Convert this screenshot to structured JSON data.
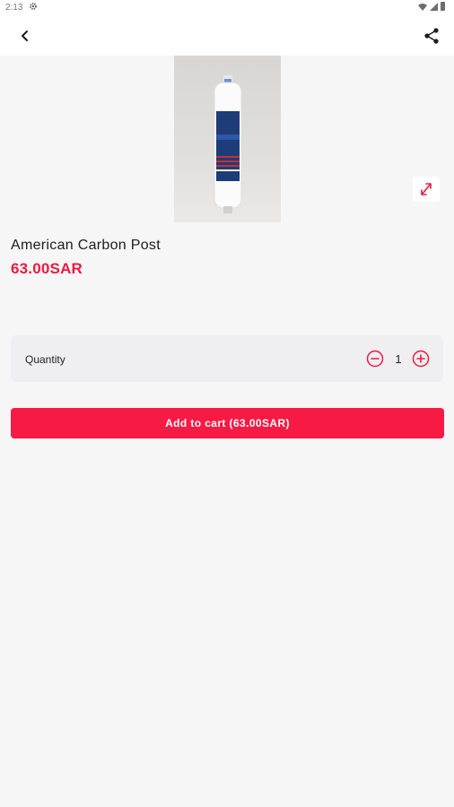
{
  "status_bar": {
    "time": "2:13",
    "icons": [
      "gear-icon",
      "wifi-icon",
      "signal-icon",
      "battery-icon"
    ]
  },
  "app_bar": {
    "back_icon": "chevron-left-icon",
    "share_icon": "share-icon"
  },
  "product": {
    "image_description": "water filter cartridge photo",
    "expand_icon": "expand-icon",
    "title": "American Carbon Post",
    "price": "63.00SAR"
  },
  "quantity": {
    "label": "Quantity",
    "value": "1",
    "minus_icon": "minus-circle-icon",
    "plus_icon": "plus-circle-icon"
  },
  "cart": {
    "button_label": "Add to cart (63.00SAR)"
  },
  "colors": {
    "accent": "#f71a45",
    "price": "#f0183f",
    "background": "#f6f6f7",
    "card": "#efeff1"
  }
}
